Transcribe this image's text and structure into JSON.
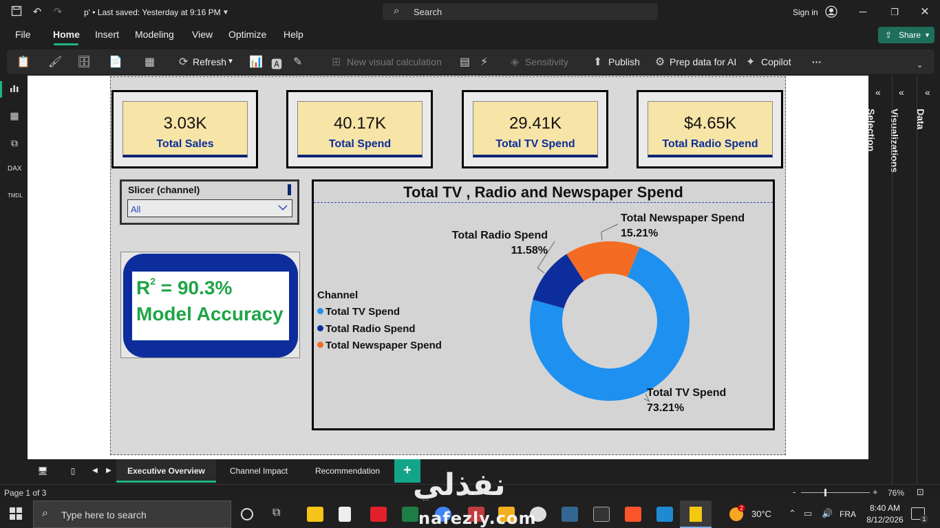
{
  "titlebar": {
    "doc_title": "p' • Last saved: Yesterday at 9:16 PM",
    "search_placeholder": "Search",
    "signin": "Sign in"
  },
  "menu": {
    "items": [
      "File",
      "Home",
      "Insert",
      "Modeling",
      "View",
      "Optimize",
      "Help"
    ],
    "active": "Home",
    "share": "Share"
  },
  "ribbon": {
    "refresh": "Refresh",
    "new_visual_calc": "New visual calculation",
    "sensitivity": "Sensitivity",
    "publish": "Publish",
    "prep_data": "Prep data for AI",
    "copilot": "Copilot",
    "more": "···"
  },
  "kpis": [
    {
      "value": "3.03K",
      "label": "Total Sales"
    },
    {
      "value": "40.17K",
      "label": "Total Spend"
    },
    {
      "value": "29.41K",
      "label": "Total TV Spend"
    },
    {
      "value": "$4.65K",
      "label": "Total Radio Spend"
    }
  ],
  "slicer": {
    "title": "Slicer (channel)",
    "value": "All"
  },
  "r2_card": {
    "r_letter": "R",
    "exponent": "2",
    "value_text": " = 90.3%",
    "line2": "Model Accuracy"
  },
  "donut": {
    "title": "Total TV , Radio and Newspaper Spend",
    "legend_title": "Channel"
  },
  "chart_data": {
    "type": "pie",
    "title": "Total TV , Radio and Newspaper Spend",
    "legend_title": "Channel",
    "legend_placement": "left",
    "donut": true,
    "categories": [
      "Total TV Spend",
      "Total Radio Spend",
      "Total Newspaper Spend"
    ],
    "values": [
      73.21,
      11.58,
      15.21
    ],
    "value_labels": [
      "73.21%",
      "11.58%",
      "15.21%"
    ],
    "colors": [
      "#1e90f0",
      "#0e2d9c",
      "#f46b23"
    ]
  },
  "pages": {
    "tabs": [
      "Executive Overview",
      "Channel Impact",
      "Recommendation"
    ],
    "active": "Executive Overview",
    "add": "+"
  },
  "right_panels": [
    "Selection",
    "Visualizations",
    "Data"
  ],
  "status": {
    "page": "Page 1 of 3",
    "zoom": "76%",
    "zoom_minus": "-",
    "zoom_plus": "+",
    "zoom_level": 0.5
  },
  "taskbar": {
    "search_placeholder": "Type here to search",
    "temperature": "30°C",
    "language": "FRA",
    "time": "8:40 AM",
    "date": "8/12/2026",
    "notif_count": "1",
    "weather_badge": "2"
  },
  "watermark": {
    "arabic": "نفذلي",
    "latin": "nafezly.com"
  }
}
